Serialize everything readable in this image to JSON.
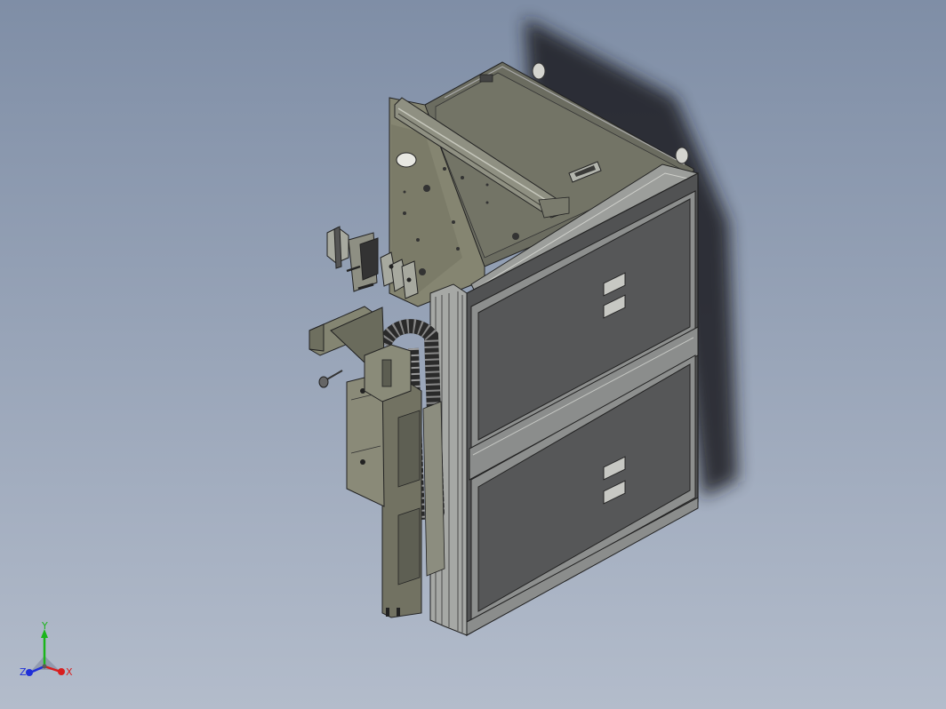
{
  "viewport": {
    "background_top": "#7f8ea6",
    "background_bottom": "#b3bccb"
  },
  "model": {
    "body_color": "#58595a",
    "frame_color": "#8b8d8c",
    "plate_color": "#727262",
    "cover_color": "#6b6c60"
  },
  "triad": {
    "x_label": "X",
    "y_label": "Y",
    "z_label": "Z",
    "x_color": "#d81e1e",
    "y_color": "#1bb51b",
    "z_color": "#1f2fd8"
  }
}
